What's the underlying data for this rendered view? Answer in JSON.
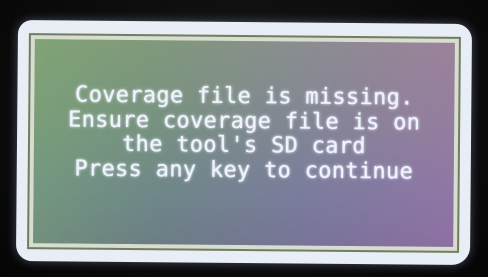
{
  "dialog": {
    "lines": [
      "Coverage file is missing.",
      "Ensure coverage file is on",
      "the tool's SD card",
      "Press any key to continue"
    ]
  }
}
